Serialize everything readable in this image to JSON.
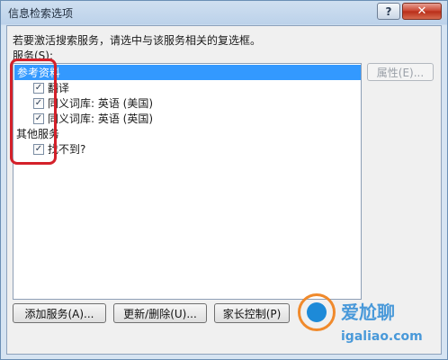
{
  "window": {
    "title": "信息检索选项",
    "help_label": "?",
    "close_label": "✕"
  },
  "dialog": {
    "instruction": "若要激活搜索服务，请选中与该服务相关的复选框。",
    "services_label": "服务(S):",
    "properties_label": "属性(E)..."
  },
  "tree": {
    "category_1": "参考资料",
    "items_1": [
      "翻译",
      "同义词库: 英语 (美国)",
      "同义词库: 英语 (英国)"
    ],
    "category_2": "其他服务",
    "items_2": [
      "找不到?"
    ],
    "check_mark": "✓"
  },
  "buttons": {
    "add_service": "添加服务(A)...",
    "update_remove": "更新/删除(U)...",
    "parental_control": "家长控制(P)"
  },
  "watermark": {
    "text": "爱尬聊",
    "url": "igaliao.com"
  }
}
